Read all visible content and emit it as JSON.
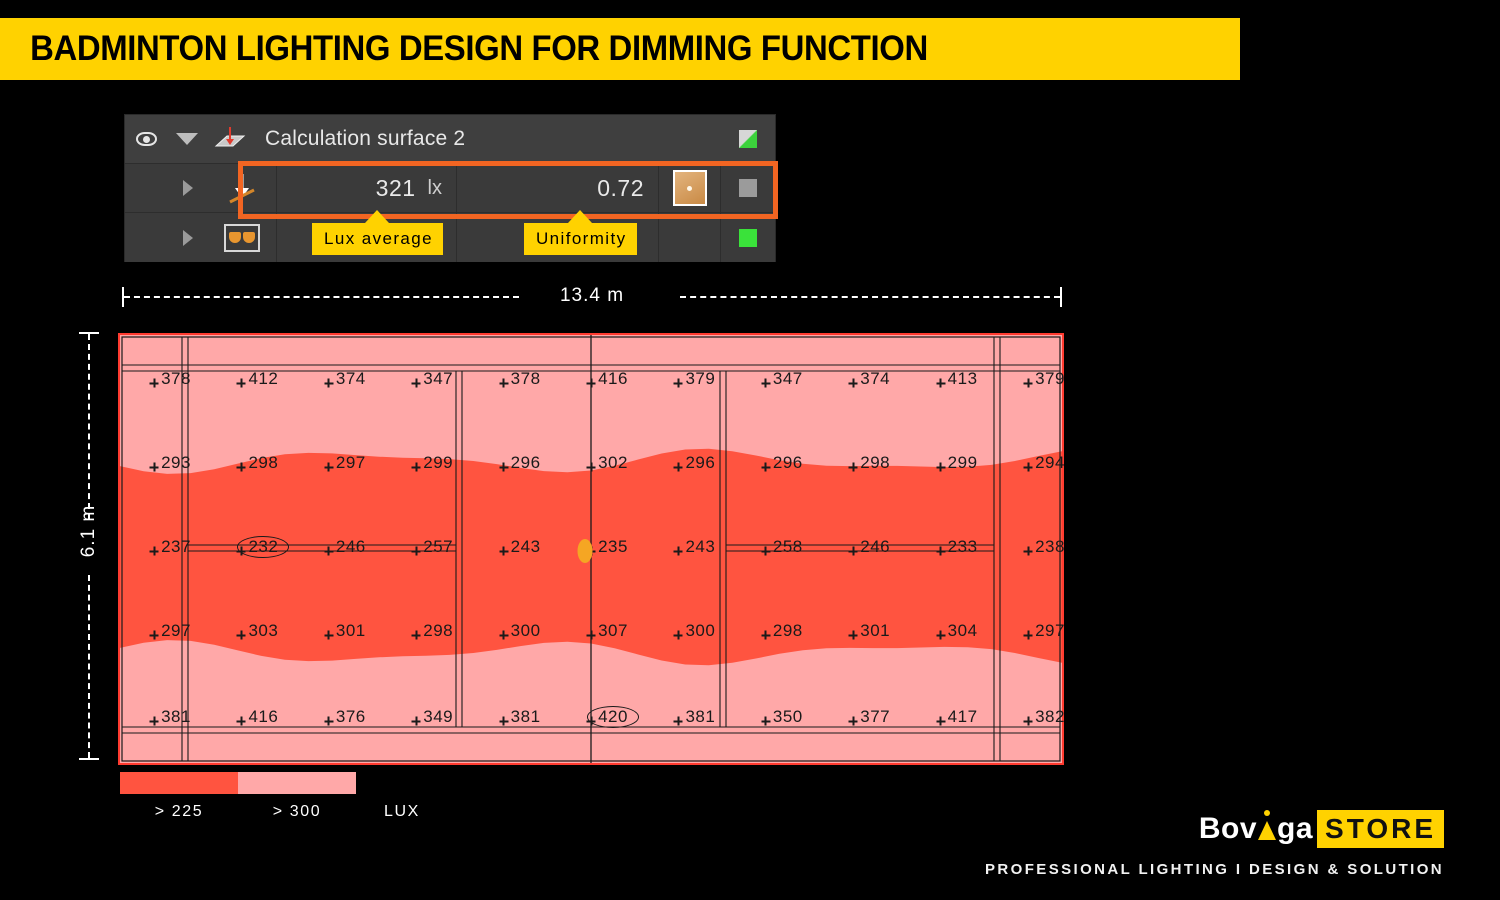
{
  "title": "BADMINTON LIGHTING DESIGN FOR DIMMING FUNCTION",
  "panel": {
    "surface_name": "Calculation surface 2",
    "lux_value": "321",
    "lux_unit": "lx",
    "uniformity_value": "0.72",
    "callout_lux": "Lux average",
    "callout_uniformity": "Uniformity",
    "highlight_color": "#F26522",
    "callout_color": "#FFD200"
  },
  "dimensions": {
    "width_label": "13.4 m",
    "height_label": "6.1 m"
  },
  "legend": {
    "bands": [
      {
        "label": "> 225",
        "color": "#FF5440"
      },
      {
        "label": "> 300",
        "color": "#FFA8A8"
      }
    ],
    "unit": "LUX"
  },
  "brand": {
    "name_dark": "Bov",
    "name_dark2": "ga",
    "name_highlight": "STORE",
    "tagline": "PROFESSIONAL LIGHTING I DESIGN & SOLUTION"
  },
  "chart_data": {
    "type": "heatmap",
    "title": "Calculation surface 2 — illuminance grid",
    "unit": "lx",
    "average": 321,
    "uniformity": 0.72,
    "minimum": 232,
    "maximum": 420,
    "xlabel": "13.4 m",
    "ylabel": "6.1 m",
    "colorbands": [
      {
        "threshold": 225,
        "color": "#FF5440"
      },
      {
        "threshold": 300,
        "color": "#FFA8A8"
      }
    ],
    "columns": 11,
    "rows": 5,
    "values": [
      [
        378,
        412,
        374,
        347,
        378,
        416,
        379,
        347,
        374,
        413,
        379
      ],
      [
        293,
        298,
        297,
        299,
        296,
        302,
        296,
        296,
        298,
        299,
        294
      ],
      [
        237,
        232,
        246,
        257,
        243,
        235,
        243,
        258,
        246,
        233,
        238
      ],
      [
        297,
        303,
        301,
        298,
        300,
        307,
        300,
        298,
        301,
        304,
        297
      ],
      [
        381,
        416,
        376,
        349,
        381,
        420,
        381,
        350,
        377,
        417,
        382
      ]
    ],
    "marked_cells": [
      {
        "row": 2,
        "col": 1,
        "value": 232,
        "kind": "minimum"
      },
      {
        "row": 4,
        "col": 5,
        "value": 420,
        "kind": "maximum"
      }
    ]
  }
}
